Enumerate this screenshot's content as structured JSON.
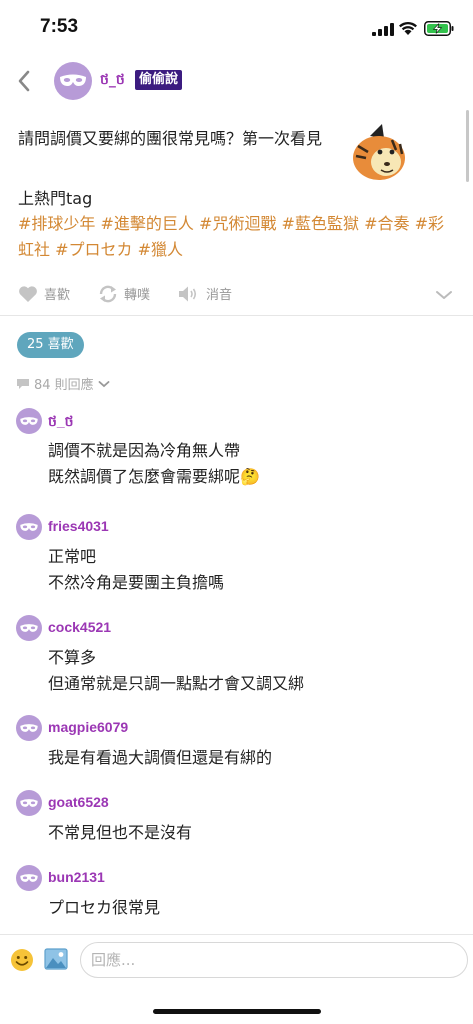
{
  "status_bar": {
    "time": "7:53",
    "icons": [
      "cellular-signal-icon",
      "wifi-icon",
      "battery-charging-icon"
    ]
  },
  "header": {
    "back_icon": "chevron-left-icon",
    "author_name": "ថ_ថ",
    "anonymous_badge": "偷偷說"
  },
  "post": {
    "question": "請問調價又要綁的團很常見嗎？第一次看見",
    "tag_intro": "上熱門tag",
    "tags": [
      "#排球少年",
      "#進擊的巨人",
      "#咒術迴戰",
      "#藍色監獄",
      "#合奏",
      "#彩虹社",
      "#プロセカ",
      "#獵人"
    ]
  },
  "actions": {
    "like_label": "喜歡",
    "share_label": "轉噗",
    "mute_label": "消音"
  },
  "likes": {
    "label": "25 喜歡"
  },
  "replies": {
    "label": "84 則回應"
  },
  "comments": [
    {
      "user": "ថ_ថ",
      "lines": [
        "調價不就是因為冷角無人帶",
        "既然調價了怎麼會需要綁呢🤔"
      ]
    },
    {
      "user": "fries4031",
      "lines": [
        "正常吧",
        "不然冷角是要團主負擔嗎"
      ]
    },
    {
      "user": "cock4521",
      "lines": [
        "不算多",
        "但通常就是只調一點點才會又調又綁"
      ]
    },
    {
      "user": "magpie6079",
      "lines": [
        "我是有看過大調價但還是有綁的"
      ]
    },
    {
      "user": "goat6528",
      "lines": [
        "不常見但也不是沒有"
      ]
    },
    {
      "user": "bun2131",
      "lines": [
        "プロセカ很常見"
      ]
    }
  ],
  "composer": {
    "placeholder": "回應...",
    "emoji_icon": "smiley-face-icon",
    "image_icon": "image-upload-icon"
  },
  "colors": {
    "username": "#9b37b4",
    "tag": "#d38834",
    "badge_bg": "#3c1c80",
    "like_pill": "#5fa6bd",
    "avatar": "#b79bd7"
  }
}
